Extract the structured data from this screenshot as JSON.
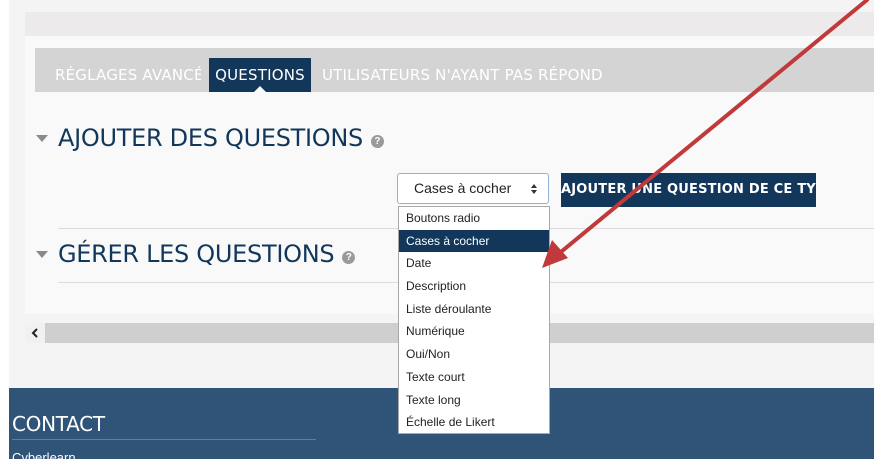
{
  "tabs": [
    {
      "label": "RÉGLAGES AVANCÉS",
      "active": false
    },
    {
      "label": "QUESTIONS",
      "active": true
    },
    {
      "label": "UTILISATEURS N'AYANT PAS RÉPONDU",
      "active": false
    }
  ],
  "sections": {
    "add": {
      "title": "AJOUTER DES QUESTIONS",
      "help": "?"
    },
    "manage": {
      "title": "GÉRER LES QUESTIONS",
      "help": "?"
    }
  },
  "question_type_select": {
    "selected": "Cases à cocher",
    "options": [
      "Boutons radio",
      "Cases à cocher",
      "Date",
      "Description",
      "Liste déroulante",
      "Numérique",
      "Oui/Non",
      "Texte court",
      "Texte long",
      "Échelle de Likert"
    ]
  },
  "add_button": {
    "label": "AJOUTER UNE QUESTION DE CE TYPE"
  },
  "scrollbar": {
    "left_arrow": "<"
  },
  "footer": {
    "heading": "CONTACT",
    "org": "Cyberlearn"
  },
  "colors": {
    "brand": "#12375a",
    "footer": "#2f5478",
    "annotation_arrow": "#c0393b"
  }
}
